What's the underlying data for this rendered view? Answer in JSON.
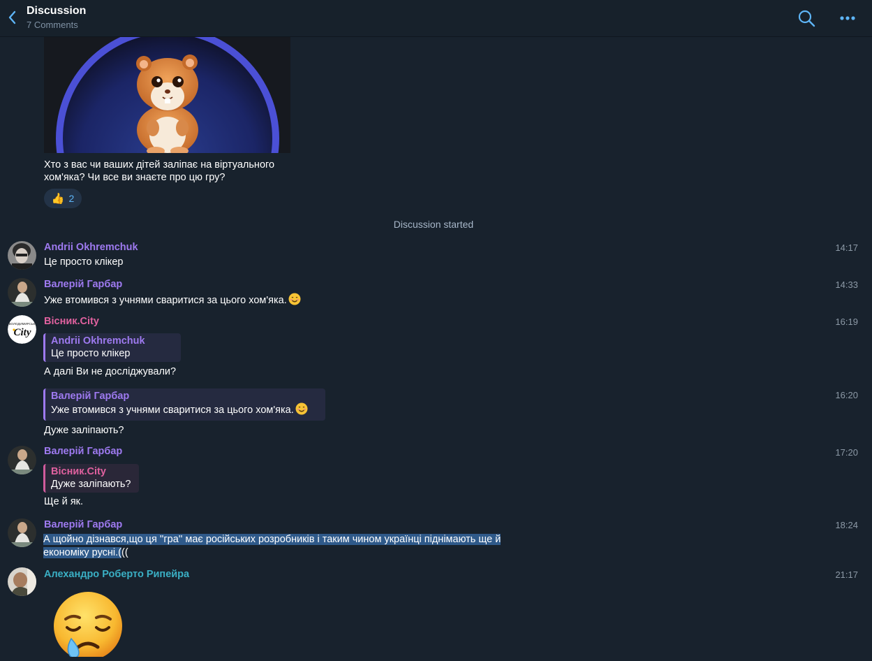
{
  "header": {
    "title": "Discussion",
    "subtitle": "7 Comments"
  },
  "post": {
    "text_line1": "Хто з вас чи ваших дітей заліпає на віртуального",
    "text_line2": "хом'яка? Чи все ви знаєте про цю гру?",
    "reaction_emoji": "👍",
    "reaction_count": "2"
  },
  "service": {
    "text": "Discussion started"
  },
  "messages": [
    {
      "sender": "Andrii Okhremchuk",
      "time": "14:17",
      "text": "Це просто клікер"
    },
    {
      "sender": "Валерій Гарбар",
      "time": "14:33",
      "text": "Уже втомився з учнями сваритися за цього хом'яка."
    },
    {
      "sender": "Вісник.City",
      "time": "16:19",
      "reply_name": "Andrii Okhremchuk",
      "reply_text": "Це просто клікер",
      "text": "А далі Ви не досліджували?"
    },
    {
      "time": "16:20",
      "reply_name": "Валерій Гарбар",
      "reply_text": "Уже втомився з учнями сваритися за цього хом'яка.",
      "text": "Дуже заліпають?"
    },
    {
      "sender": "Валерій Гарбар",
      "time": "17:20",
      "reply_name": "Вісник.City",
      "reply_text": "Дуже заліпають?",
      "text": "Ще й як."
    },
    {
      "sender": "Валерій Гарбар",
      "time": "18:24",
      "text_line1": "А щойно дізнався,що ця ''гра'' має російських розробників і таким чином українці піднімають ще й",
      "text_line2_selected": "економіку русні.(",
      "text_line2_rest": "(("
    },
    {
      "sender": "Алехандро Роберто Рипейра",
      "time": "21:17",
      "emoji": "sad-tear-emoji"
    }
  ],
  "avatar_labels": {
    "visnyk_small": "ВОЛОДИМИРСЬК",
    "visnyk_big": "City"
  },
  "colors": {
    "background": "#18222d",
    "header": "#17212b",
    "accent": "#5eb5f7",
    "name_purple": "#9e7af0",
    "name_pink": "#e0619f",
    "name_teal": "#3aafc4",
    "selection": "#2f5a8a"
  },
  "icons": [
    "back-chevron-icon",
    "search-icon",
    "more-dots-icon",
    "thumbs-up-icon",
    "smiling-face-icon",
    "sad-tear-emoji"
  ]
}
